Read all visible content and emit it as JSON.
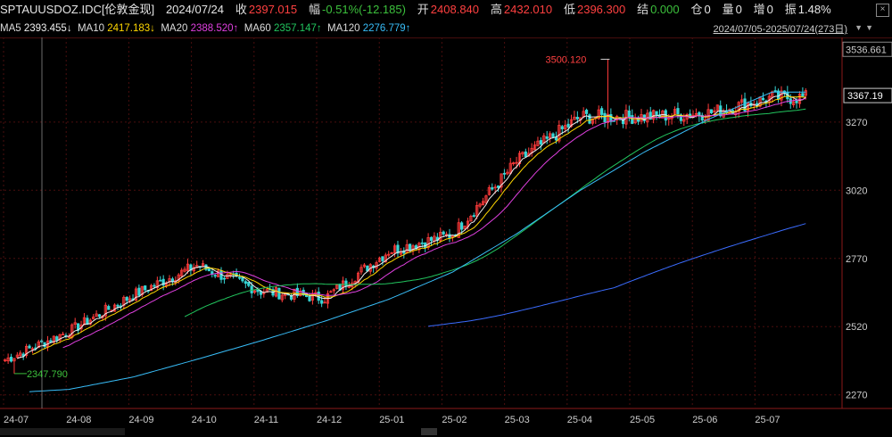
{
  "header": {
    "symbol": "SPTAUUSDOZ.IDC[伦敦金现]",
    "date": "2024/07/24",
    "close_label": "收",
    "close_value": "2397.015",
    "change_label": "幅",
    "change_value": "-0.51%(-12.185)",
    "open_label": "开",
    "open_value": "2408.840",
    "high_label": "高",
    "high_value": "2432.010",
    "low_label": "低",
    "low_value": "2396.300",
    "settle_label": "结",
    "settle_value": "0.000",
    "oi_label": "仓",
    "oi_value": "0",
    "vol_label": "量",
    "vol_value": "0",
    "inc_label": "增",
    "inc_value": "0",
    "amp_label": "振",
    "amp_value": "1.48%"
  },
  "ma_line": {
    "ma5_label": "MA5",
    "ma5_value": "2393.455↓",
    "ma10_label": "MA10",
    "ma10_value": "2417.183↓",
    "ma20_label": "MA20",
    "ma20_value": "2388.520↑",
    "ma60_label": "MA60",
    "ma60_value": "2357.147↑",
    "ma120_label": "MA120",
    "ma120_value": "2276.779↑",
    "range": "2024/07/05-2025/07/24(273日)"
  },
  "colors": {
    "up": "#ff3b3b",
    "down": "#36d6d6",
    "ma5": "#f0f0f0",
    "ma10": "#ffd700",
    "ma20": "#e040e0",
    "ma60": "#22c55e",
    "ma120": "#38bdf8",
    "ma250": "#3b6cff",
    "grid": "#4a0e0e"
  },
  "chart_data": {
    "type": "candlestick",
    "x_ticks": [
      "24-07",
      "24-08",
      "24-09",
      "24-10",
      "24-11",
      "24-12",
      "25-01",
      "25-02",
      "25-03",
      "25-04",
      "25-05",
      "25-06",
      "25-07"
    ],
    "y_ticks": [
      2270,
      2520,
      2770,
      3020,
      3270
    ],
    "ylim": [
      2220,
      3580
    ],
    "price_top_label": "3536.661",
    "price_current_label": "3367.19",
    "annotations": [
      {
        "text": "3500.120",
        "value": 3500.12
      },
      {
        "text": "2347.790",
        "value": 2347.79
      }
    ],
    "monthly_closes": [
      2398,
      2503,
      2635,
      2745,
      2650,
      2624,
      2797,
      2858,
      3124,
      3289,
      3289,
      3303,
      3360
    ],
    "ma120_trend": [
      2276,
      2290,
      2335,
      2400,
      2468,
      2540,
      2620,
      2720,
      2860,
      3020,
      3160,
      3280,
      3380
    ]
  }
}
